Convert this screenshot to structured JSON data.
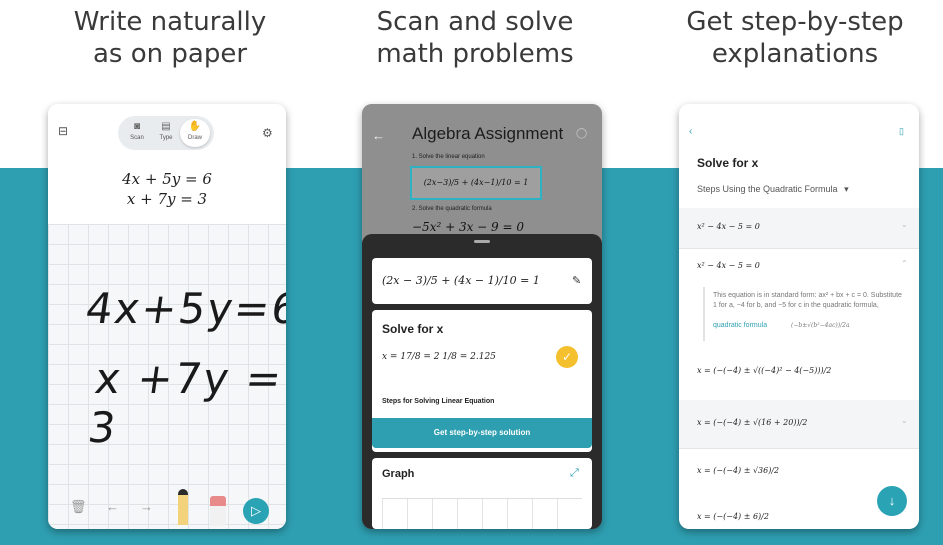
{
  "captions": {
    "c1_l1": "Write naturally",
    "c1_l2": "as on paper",
    "c2_l1": "Scan and solve",
    "c2_l2": "math problems",
    "c3_l1": "Get step-by-step",
    "c3_l2": "explanations"
  },
  "phone1": {
    "modes": [
      {
        "label": "Scan",
        "icon": "camera-icon"
      },
      {
        "label": "Type",
        "icon": "keyboard-icon"
      },
      {
        "label": "Draw",
        "icon": "hand-icon"
      }
    ],
    "eq1": "4x + 5y = 6",
    "eq2": "x + 7y = 3",
    "hand1": "4x+5y=6",
    "hand2": "x +7y = 3",
    "icons": [
      "delete-icon",
      "undo-icon",
      "redo-icon",
      "pencil-icon",
      "eraser-icon",
      "submit-icon"
    ]
  },
  "phone2": {
    "title": "Algebra Assignment",
    "step1": "1. Solve the linear equation",
    "step2": "2. Solve the quadratic formula",
    "eq_photo": "(2x−3)/5 + (4x−1)/10 = 1",
    "eq_photo2": "−5x² + 3x − 9 = 0",
    "eq_card": "(2x − 3)/5 + (4x − 1)/10 = 1",
    "solve_title": "Solve for x",
    "solution": "x = 17/8 = 2 1/8 = 2.125",
    "steps_label": "Steps for Solving Linear Equation",
    "cta": "Get step-by-step solution",
    "graph_title": "Graph"
  },
  "phone3": {
    "title": "Solve for x",
    "method": "Steps Using the Quadratic Formula",
    "eq1": "x² − 4x − 5 = 0",
    "eq2": "x² − 4x − 5 = 0",
    "explanation": "This equation is in standard form: ax² + bx + c = 0. Substitute 1 for a, −4 for b, and −5 for c in the quadratic formula,",
    "link": "quadratic formula",
    "formula": "(−b±√(b²−4ac))/2a",
    "s1": "x = (−(−4) ± √((−4)² − 4(−5)))/2",
    "s2": "x = (−(−4) ± √(16 + 20))/2",
    "s3": "x = (−(−4) ± √36)/2",
    "s4": "x = (−(−4) ± 6)/2"
  }
}
